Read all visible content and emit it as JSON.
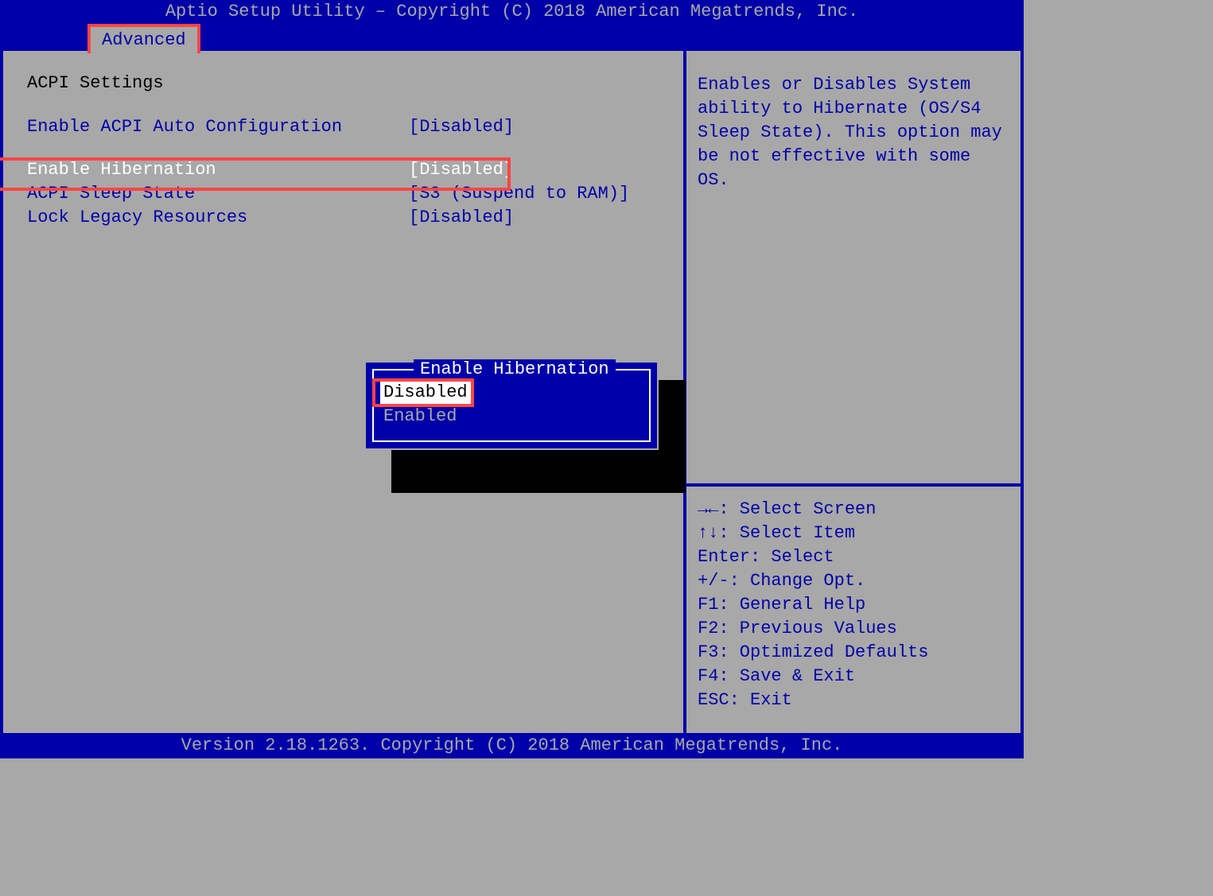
{
  "header": {
    "title": "Aptio Setup Utility – Copyright (C) 2018 American Megatrends, Inc."
  },
  "tab": {
    "label": "Advanced"
  },
  "section": {
    "title": "ACPI Settings"
  },
  "settings": [
    {
      "label": "Enable ACPI Auto Configuration",
      "value": "[Disabled]"
    },
    {
      "label": "Enable Hibernation",
      "value": "[Disabled]"
    },
    {
      "label": "ACPI Sleep State",
      "value": "[S3 (Suspend to RAM)]"
    },
    {
      "label": "Lock Legacy Resources",
      "value": "[Disabled]"
    }
  ],
  "popup": {
    "title": "Enable Hibernation",
    "options": [
      "Disabled",
      "Enabled"
    ]
  },
  "help_text": "Enables or Disables System ability to Hibernate (OS/S4 Sleep State). This option may be not effective with some OS.",
  "hints": [
    "→←: Select Screen",
    "↑↓: Select Item",
    "Enter: Select",
    "+/-: Change Opt.",
    "F1: General Help",
    "F2: Previous Values",
    "F3: Optimized Defaults",
    "F4: Save & Exit",
    "ESC: Exit"
  ],
  "footer": {
    "text": "Version 2.18.1263. Copyright (C) 2018 American Megatrends, Inc."
  }
}
